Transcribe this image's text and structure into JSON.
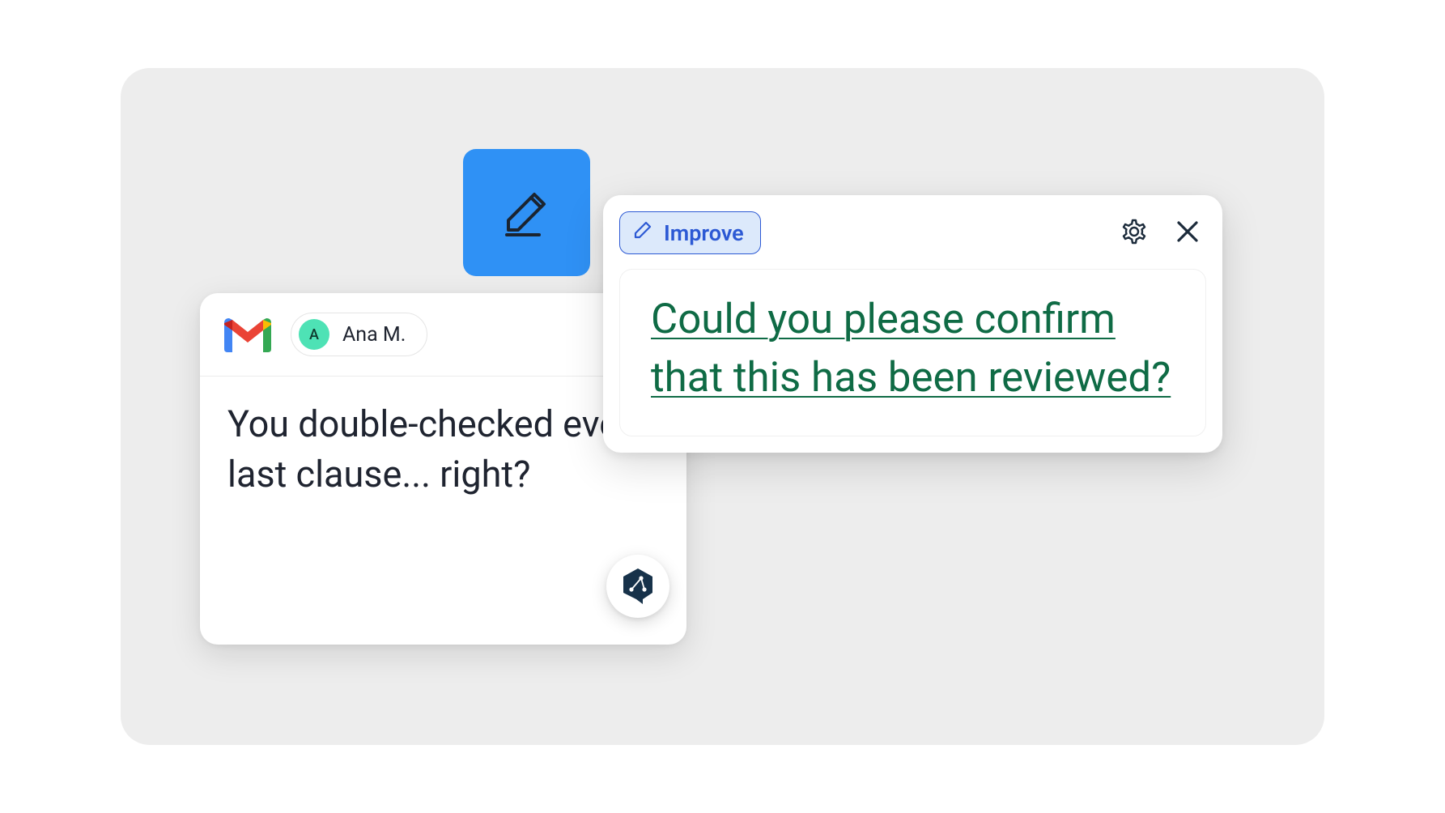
{
  "edit_tile": {
    "icon": "pencil-icon"
  },
  "gmail_card": {
    "sender": {
      "initial": "A",
      "name": "Ana M."
    },
    "message": "You double-checked every last clause... right?"
  },
  "fab": {
    "icon": "share-hex-icon"
  },
  "suggestion_popup": {
    "improve_label": "Improve",
    "suggestion": "Could you please confirm that this has been reviewed?"
  },
  "colors": {
    "stage_bg": "#EDEDED",
    "edit_tile": "#2F91F5",
    "improve_accent": "#2C59D4",
    "suggestion_text": "#0F6B45"
  }
}
